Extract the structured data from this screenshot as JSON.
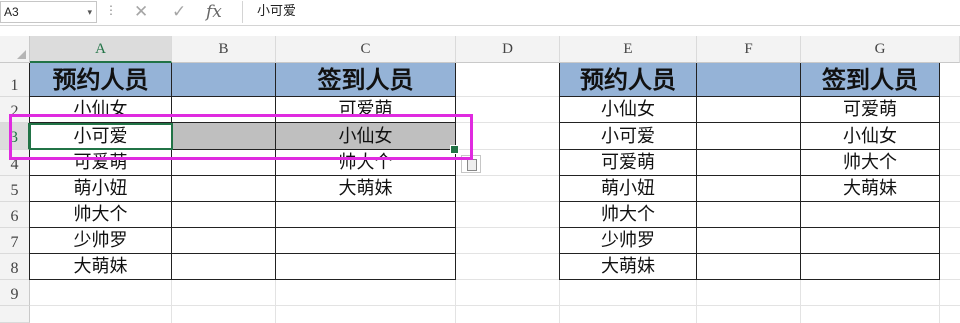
{
  "formula_bar": {
    "name_box": "A3",
    "dropdown_icon": "▾",
    "dots": "⋮",
    "cancel_glyph": "✕",
    "enter_glyph": "✓",
    "fx_glyph": "fx",
    "content": "小可爱"
  },
  "columns": [
    "A",
    "B",
    "C",
    "D",
    "E",
    "F",
    "G"
  ],
  "rows": [
    "1",
    "2",
    "3",
    "4",
    "5",
    "6",
    "7",
    "8",
    "9"
  ],
  "left_table": {
    "header_a": "预约人员",
    "header_c": "签到人员",
    "col_a": [
      "小仙女",
      "小可爱",
      "可爱萌",
      "萌小妞",
      "帅大个",
      "少帅罗",
      "大萌妹"
    ],
    "col_c": [
      "可爱萌",
      "小仙女",
      "帅大个",
      "大萌妹",
      "",
      "",
      ""
    ]
  },
  "right_table": {
    "header_e": "预约人员",
    "header_g": "签到人员",
    "col_e": [
      "小仙女",
      "小可爱",
      "可爱萌",
      "萌小妞",
      "帅大个",
      "少帅罗",
      "大萌妹"
    ],
    "col_g": [
      "可爱萌",
      "小仙女",
      "帅大个",
      "大萌妹",
      "",
      "",
      ""
    ]
  },
  "colors": {
    "header_fill": "#95b3d7",
    "highlight_fill": "#bfbfbf",
    "annotation": "#e02ae0",
    "excel_green": "#217346"
  }
}
